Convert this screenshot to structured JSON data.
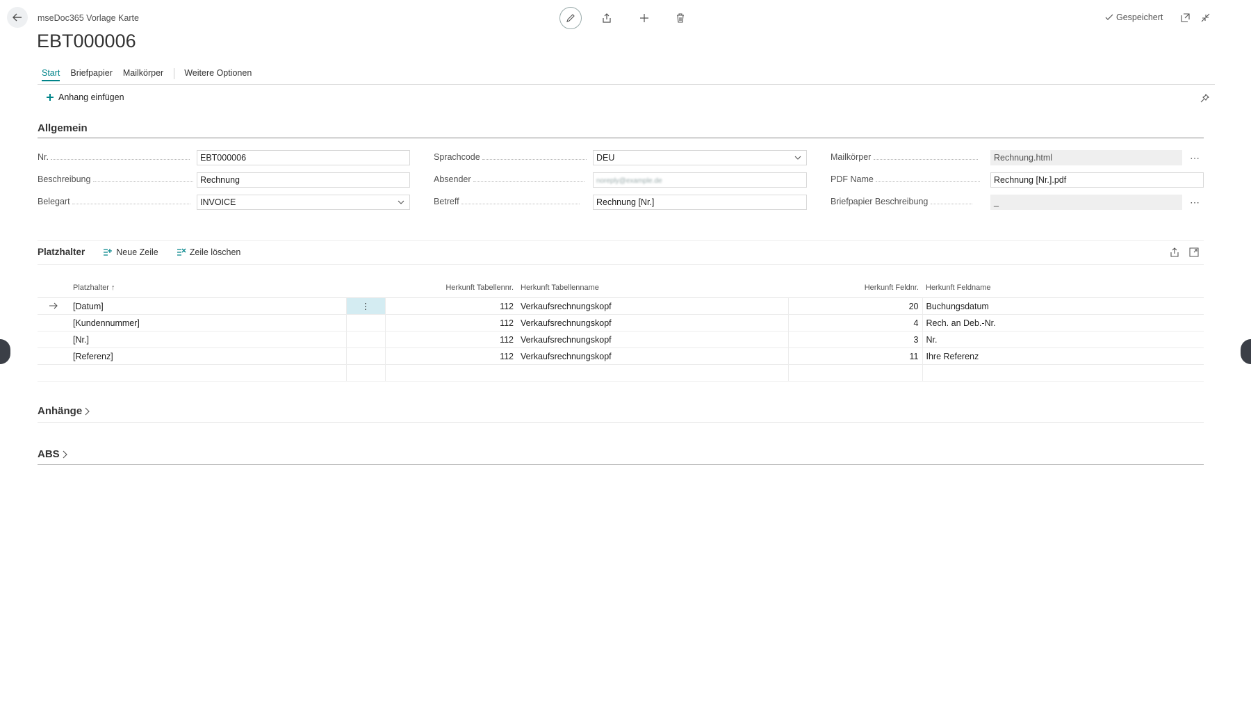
{
  "header": {
    "breadcrumb": "mseDoc365 Vorlage Karte",
    "title": "EBT000006",
    "status": "Gespeichert"
  },
  "tabs": [
    {
      "label": "Start",
      "active": true
    },
    {
      "label": "Briefpapier"
    },
    {
      "label": "Mailkörper"
    },
    {
      "label": "Weitere Optionen"
    }
  ],
  "actions": {
    "attach_label": "Anhang einfügen"
  },
  "general": {
    "section_title": "Allgemein",
    "nr": {
      "label": "Nr.",
      "value": "EBT000006"
    },
    "beschreibung": {
      "label": "Beschreibung",
      "value": "Rechnung"
    },
    "belegart": {
      "label": "Belegart",
      "value": "INVOICE"
    },
    "sprachcode": {
      "label": "Sprachcode",
      "value": "DEU"
    },
    "absender": {
      "label": "Absender",
      "value": "noreply@example.de"
    },
    "betreff": {
      "label": "Betreff",
      "value": "Rechnung [Nr.]"
    },
    "mailkoerper": {
      "label": "Mailkörper",
      "value": "Rechnung.html"
    },
    "pdf_name": {
      "label": "PDF Name",
      "value": "Rechnung [Nr.].pdf"
    },
    "briefpapier": {
      "label": "Briefpapier Beschreibung",
      "value": "_"
    }
  },
  "placeholders": {
    "title": "Platzhalter",
    "new_line": "Neue Zeile",
    "delete_line": "Zeile löschen",
    "columns": {
      "placeholder": "Platzhalter ↑",
      "table_no": "Herkunft Tabellennr.",
      "table_name": "Herkunft Tabellenname",
      "field_no": "Herkunft Feldnr.",
      "field_name": "Herkunft Feldname"
    },
    "rows": [
      {
        "placeholder": "[Datum]",
        "table_no": "112",
        "table_name": "Verkaufsrechnungskopf",
        "field_no": "20",
        "field_name": "Buchungsdatum"
      },
      {
        "placeholder": "[Kundennummer]",
        "table_no": "112",
        "table_name": "Verkaufsrechnungskopf",
        "field_no": "4",
        "field_name": "Rech. an Deb.-Nr."
      },
      {
        "placeholder": "[Nr.]",
        "table_no": "112",
        "table_name": "Verkaufsrechnungskopf",
        "field_no": "3",
        "field_name": "Nr."
      },
      {
        "placeholder": "[Referenz]",
        "table_no": "112",
        "table_name": "Verkaufsrechnungskopf",
        "field_no": "11",
        "field_name": "Ihre Referenz"
      }
    ]
  },
  "sections": {
    "anhaenge": "Anhänge",
    "abs": "ABS"
  },
  "colors": {
    "accent": "#008489",
    "selected_cell": "#d4ecf2"
  }
}
